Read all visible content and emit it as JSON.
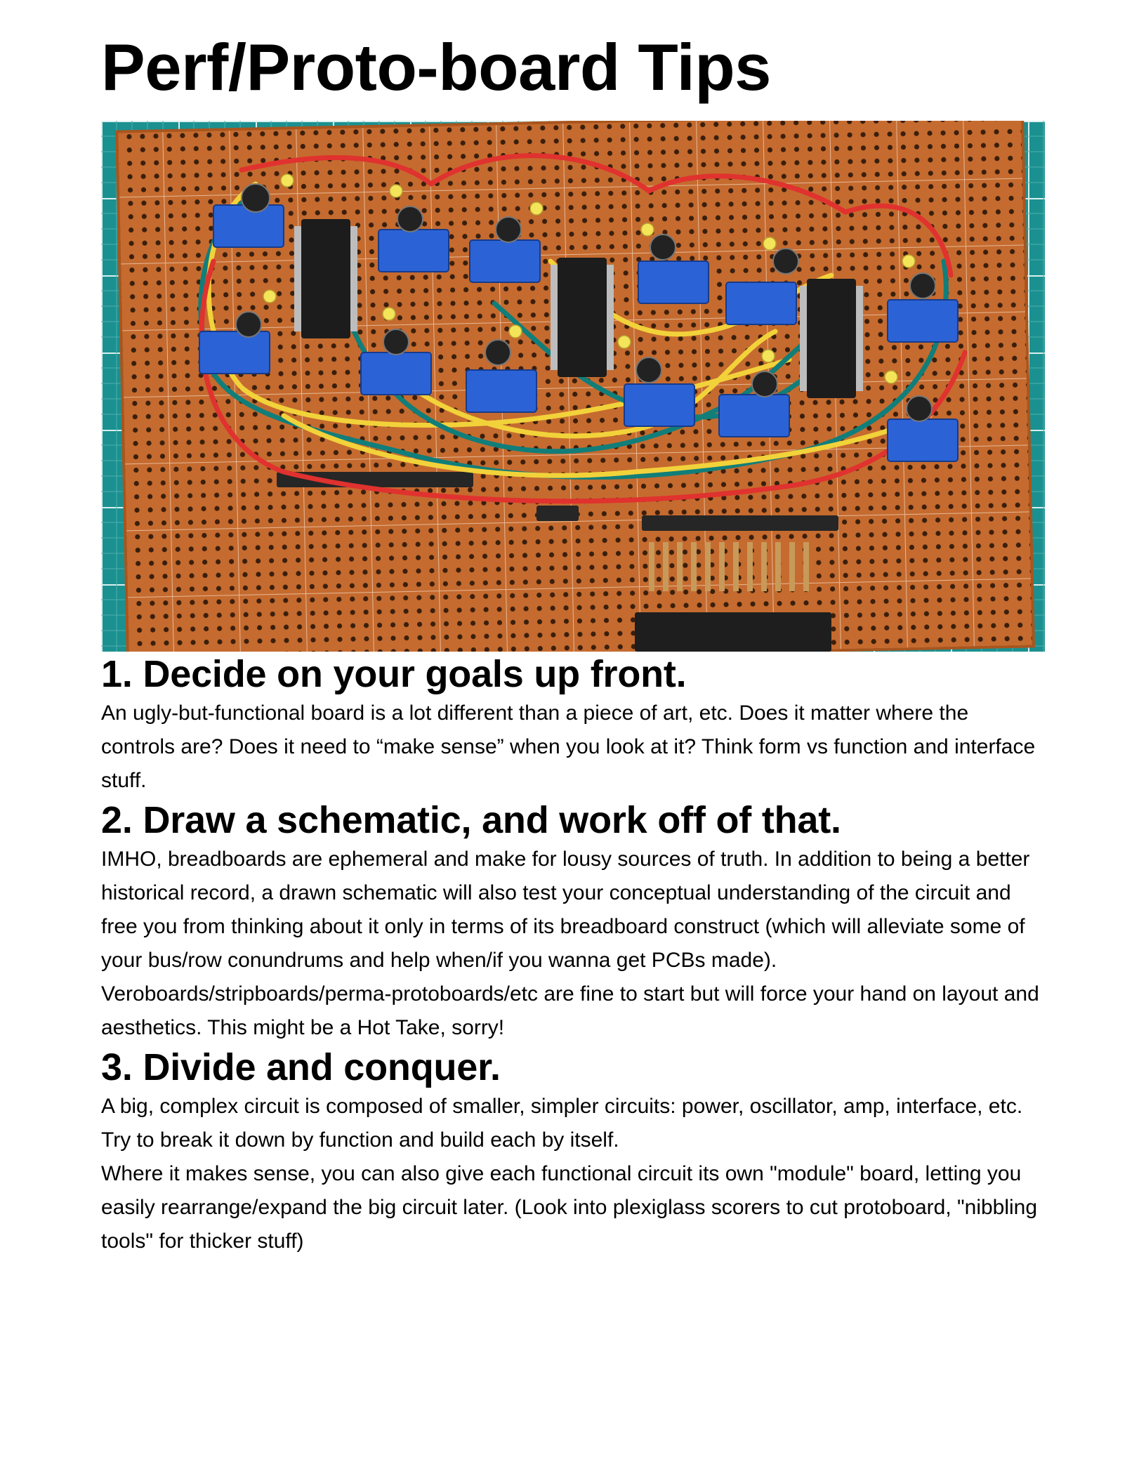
{
  "document": {
    "title": "Perf/Proto-board Tips"
  },
  "hero_image": {
    "description_icon": "circuit-board-photo",
    "colors": {
      "mat": "#1a8f8f",
      "board": "#c46a2e",
      "wire_red": "#e0322e",
      "wire_yellow": "#f2d23a",
      "wire_teal": "#117e7a",
      "trimmer": "#2b63d6",
      "ic": "#1c1c1c"
    }
  },
  "sections": [
    {
      "heading": "1. Decide on your goals up front.",
      "paragraphs": [
        "An ugly-but-functional board is a lot different than a piece of art, etc. Does it matter where the controls are? Does it need to “make sense” when you look at it? Think form vs function and interface stuff."
      ]
    },
    {
      "heading": "2. Draw a schematic, and work off of that.",
      "paragraphs": [
        "IMHO, breadboards are ephemeral and make for lousy sources of truth. In addition to being a better historical record, a drawn schematic will also test your conceptual understanding of the circuit and free you from thinking about it only in terms of its breadboard construct (which will alleviate some of your bus/row conundrums and help when/if you wanna get PCBs made).",
        "Veroboards/stripboards/perma-protoboards/etc are fine to start but will force your hand on layout and aesthetics. This might be a Hot Take, sorry!"
      ]
    },
    {
      "heading": "3. Divide and conquer.",
      "paragraphs": [
        "A big, complex circuit is composed of smaller, simpler circuits: power, oscillator, amp, interface, etc. Try to break it down by function and build each by itself.",
        "Where it makes sense, you can also give each functional circuit its own \"module\" board, letting you easily rearrange/expand the big circuit later. (Look into plexiglass scorers to cut protoboard, \"nibbling tools\" for thicker stuff)"
      ]
    }
  ]
}
